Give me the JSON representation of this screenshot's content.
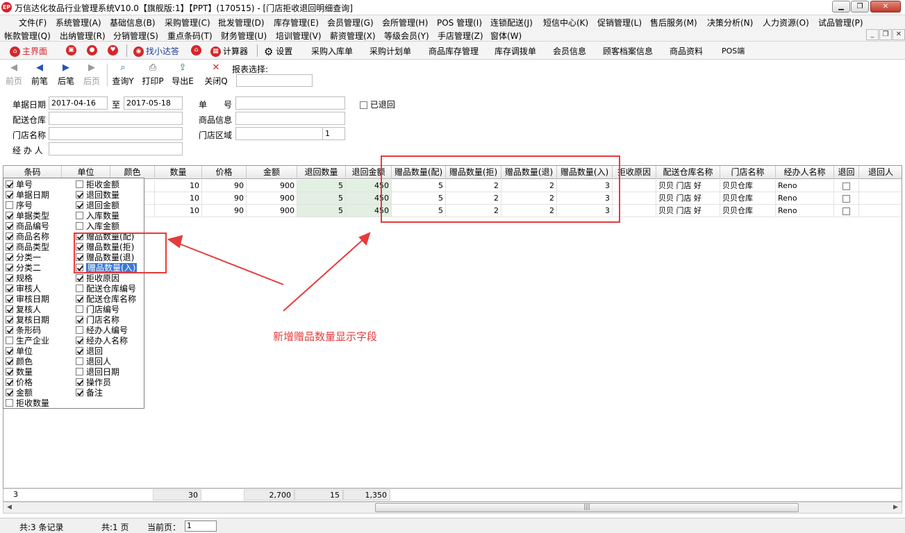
{
  "window": {
    "title": "万信达化妆品行业管理系统V10.0【旗舰版:1】【PPT】(170515) - [门店拒收退回明细查询]",
    "icon_text": "EP",
    "minimize": "▁",
    "restore": "❐",
    "close": "✕"
  },
  "menu": {
    "row1": [
      "文件(F)",
      "系统管理(A)",
      "基础信息(B)",
      "采购管理(C)",
      "批发管理(D)",
      "库存管理(E)",
      "会员管理(G)",
      "会所管理(H)",
      "POS 管理(I)",
      "连锁配送(J)",
      "短信中心(K)",
      "促销管理(L)",
      "售后服务(M)",
      "决策分析(N)",
      "人力资源(O)",
      "试品管理(P)"
    ],
    "row2": [
      "帐款管理(Q)",
      "出纳管理(R)",
      "分销管理(S)",
      "重点条码(T)",
      "财务管理(U)",
      "培训管理(V)",
      "薪资管理(X)",
      "等级会员(Y)",
      "手店管理(Z)",
      "窗体(W)"
    ],
    "mdi_min": "_",
    "mdi_restore": "❐",
    "mdi_close": "✕"
  },
  "quickbar": {
    "main": "主界面",
    "find_xiaoda": "找小达答",
    "calculator": "计算器",
    "settings": "设置",
    "items": [
      "采购入库单",
      "采购计划单",
      "商品库存管理",
      "库存调拨单",
      "会员信息",
      "顾客档案信息",
      "商品资料",
      "POS端"
    ]
  },
  "toolbar": {
    "first": "前页",
    "prev": "前笔",
    "next": "后笔",
    "last": "后页",
    "query": "查询Y",
    "print": "打印P",
    "export": "导出E",
    "close": "关闭Q",
    "report_label": "报表选择:"
  },
  "filter": {
    "date_label": "单据日期",
    "date_from": "2017-04-16",
    "to_label": "至",
    "date_to": "2017-05-18",
    "doc_no_label": "单　　号",
    "returned_label": "已退回",
    "warehouse_label": "配送仓库",
    "product_label": "商品信息",
    "store_label": "门店名称",
    "area_label": "门店区域",
    "area_value": "1",
    "handler_label": "经 办 人"
  },
  "grid": {
    "columns": [
      "条码",
      "单位",
      "颜色",
      "数量",
      "价格",
      "金额",
      "退回数量",
      "退回金额",
      "赠品数量(配)",
      "赠品数量(拒)",
      "赠品数量(退)",
      "赠品数量(入)",
      "拒收原因",
      "配送仓库名称",
      "门店名称",
      "经办人名称",
      "退回",
      "退回人"
    ],
    "rows": [
      {
        "qty": "10",
        "price": "90",
        "amount": "900",
        "ret_qty": "5",
        "ret_amount": "450",
        "g1": "5",
        "g2": "2",
        "g3": "2",
        "g4": "3",
        "warehouse": "贝贝 门店 好",
        "store": "贝贝仓库",
        "handler": "Reno"
      },
      {
        "qty": "10",
        "price": "90",
        "amount": "900",
        "ret_qty": "5",
        "ret_amount": "450",
        "g1": "5",
        "g2": "2",
        "g3": "2",
        "g4": "3",
        "warehouse": "贝贝 门店 好",
        "store": "贝贝仓库",
        "handler": "Reno"
      },
      {
        "qty": "10",
        "price": "90",
        "amount": "900",
        "ret_qty": "5",
        "ret_amount": "450",
        "g1": "5",
        "g2": "2",
        "g3": "2",
        "g4": "3",
        "warehouse": "贝贝 门店 好",
        "store": "贝贝仓库",
        "handler": "Reno"
      }
    ],
    "footer": {
      "count": "3",
      "qty_total": "30",
      "amount_total": "2,700",
      "ret_qty_total": "15",
      "ret_amount_total": "1,350"
    }
  },
  "column_chooser": {
    "left": [
      {
        "label": "单号",
        "checked": true
      },
      {
        "label": "单据日期",
        "checked": true
      },
      {
        "label": "序号",
        "checked": false
      },
      {
        "label": "单据类型",
        "checked": true
      },
      {
        "label": "商品编号",
        "checked": true
      },
      {
        "label": "商品名称",
        "checked": true
      },
      {
        "label": "商品类型",
        "checked": true
      },
      {
        "label": "分类一",
        "checked": true
      },
      {
        "label": "分类二",
        "checked": true
      },
      {
        "label": "规格",
        "checked": true
      },
      {
        "label": "审核人",
        "checked": true
      },
      {
        "label": "审核日期",
        "checked": true
      },
      {
        "label": "复核人",
        "checked": true
      },
      {
        "label": "复核日期",
        "checked": true
      },
      {
        "label": "条形码",
        "checked": true
      },
      {
        "label": "生产企业",
        "checked": false
      },
      {
        "label": "单位",
        "checked": true
      },
      {
        "label": "颜色",
        "checked": true
      },
      {
        "label": "数量",
        "checked": true
      },
      {
        "label": "价格",
        "checked": true
      },
      {
        "label": "金额",
        "checked": true
      },
      {
        "label": "拒收数量",
        "checked": false
      }
    ],
    "right": [
      {
        "label": "拒收金额",
        "checked": false
      },
      {
        "label": "退回数量",
        "checked": true
      },
      {
        "label": "退回金额",
        "checked": true
      },
      {
        "label": "入库数量",
        "checked": false
      },
      {
        "label": "入库金额",
        "checked": false
      },
      {
        "label": "赠品数量(配)",
        "checked": true
      },
      {
        "label": "赠品数量(拒)",
        "checked": true
      },
      {
        "label": "赠品数量(退)",
        "checked": true
      },
      {
        "label": "赠品数量(入)",
        "checked": true
      },
      {
        "label": "拒收原因",
        "checked": true
      },
      {
        "label": "配送仓库编号",
        "checked": false
      },
      {
        "label": "配送仓库名称",
        "checked": true
      },
      {
        "label": "门店编号",
        "checked": false
      },
      {
        "label": "门店名称",
        "checked": true
      },
      {
        "label": "经办人编号",
        "checked": false
      },
      {
        "label": "经办人名称",
        "checked": true
      },
      {
        "label": "退回",
        "checked": true
      },
      {
        "label": "退回人",
        "checked": false
      },
      {
        "label": "退回日期",
        "checked": false
      },
      {
        "label": "操作员",
        "checked": true
      },
      {
        "label": "备注",
        "checked": true
      }
    ]
  },
  "annotation": {
    "text": "新增赠品数量显示字段",
    "color": "#e63b3b"
  },
  "status": {
    "records": "共:3 条记录",
    "pages": "共:1 页",
    "current_label": "当前页：",
    "current_page": "1"
  },
  "colors": {
    "accent_red": "#d5202a",
    "highlight_blue": "#3a78d6",
    "return_green": "#e2efe2"
  }
}
